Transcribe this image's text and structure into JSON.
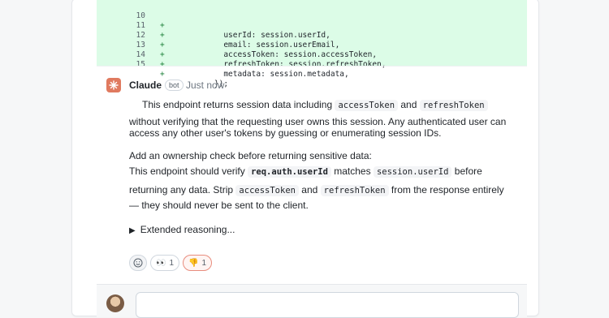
{
  "diff": {
    "lines": [
      {
        "num": "10",
        "sign": "+",
        "code": "      userId: session.userId,"
      },
      {
        "num": "11",
        "sign": "+",
        "code": "      email: session.userEmail,"
      },
      {
        "num": "12",
        "sign": "+",
        "code": "      accessToken: session.accessToken,"
      },
      {
        "num": "13",
        "sign": "+",
        "code": "      refreshToken: session.refreshToken,"
      },
      {
        "num": "14",
        "sign": "+",
        "code": "      metadata: session.metadata,"
      },
      {
        "num": "15",
        "sign": "+",
        "code": "    });"
      }
    ]
  },
  "comment": {
    "author": "Claude",
    "badge": "bot",
    "time": "Just now",
    "p1": {
      "a": "This endpoint returns session data including ",
      "code1": "accessToken",
      "b": " and ",
      "code2": "refreshToken",
      "line2": "without verifying that the requesting user owns this session. Any authenticated user can",
      "line3": "access any other user's tokens by guessing or enumerating session IDs."
    },
    "p2": {
      "line1": "Add an ownership check before returning sensitive data:",
      "a": "This endpoint should verify ",
      "code1": "req.auth.userId",
      "b": " matches ",
      "code2": "session.userId",
      "c": " before",
      "d": "returning any data. Strip ",
      "code3": "accessToken",
      "e": " and ",
      "code4": "refreshToken",
      "f": " from the response entirely",
      "line4": "— they should never be sent to the client."
    },
    "reasoning_label": "Extended reasoning...",
    "reactions": [
      {
        "icon": "eyes-icon",
        "glyph": "👀",
        "count": "1"
      },
      {
        "icon": "thumbs-down-icon",
        "glyph": "👎",
        "count": "1"
      }
    ]
  },
  "colors": {
    "diff_added_bg": "#dcfce7",
    "claude_accent": "#e07a5f",
    "active_reaction_border": "#e88c7d"
  }
}
